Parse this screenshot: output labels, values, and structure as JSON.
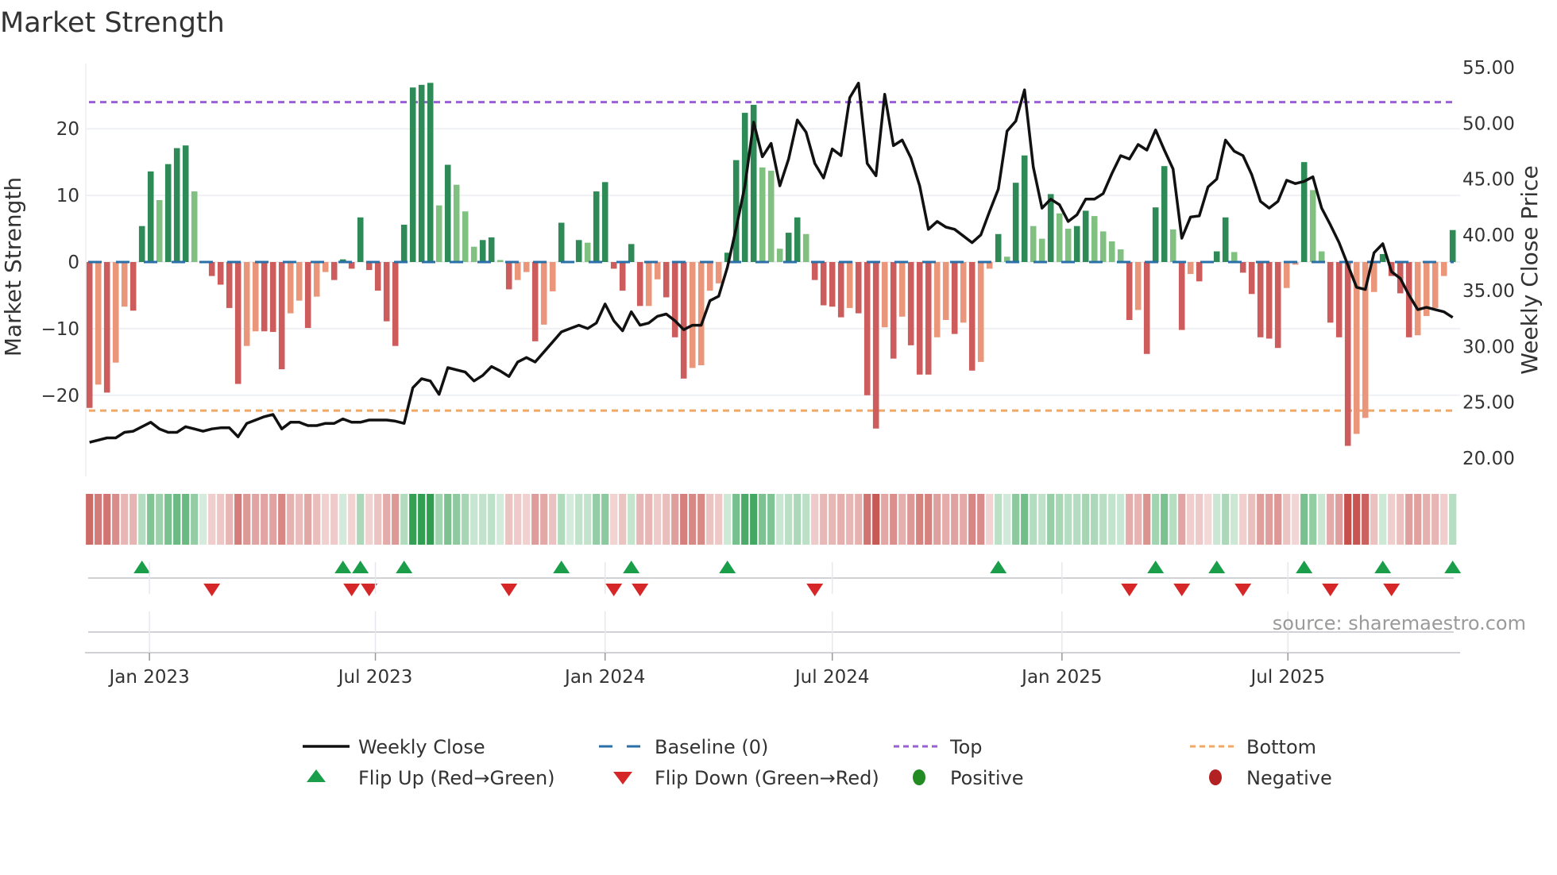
{
  "title": "Market Strength",
  "source": "source: sharemaestro.com",
  "legend": {
    "weekly_close": "Weekly Close",
    "baseline": "Baseline (0)",
    "top": "Top",
    "bottom": "Bottom",
    "flip_up": "Flip Up (Red→Green)",
    "flip_down": "Flip Down (Green→Red)",
    "positive": "Positive",
    "negative": "Negative"
  },
  "colors": {
    "strong_positive": "#2e8b57",
    "weak_positive": "#80c080",
    "strong_negative": "#cd5c5c",
    "weak_negative": "#e9967a",
    "baseline": "#2a6fa8",
    "top": "#9a5fd6",
    "bottom": "#f0a868",
    "close": "#111111",
    "flip_up": "#1a9e4a",
    "flip_down": "#d62728",
    "positive": "#228b22",
    "negative": "#b22222"
  },
  "chart_data": {
    "type": "bar+line",
    "title": "Market Strength",
    "ylabel": "Market Strength",
    "ylabel_right": "Weekly Close Price",
    "start_week": "2022-11-14",
    "frequency": "weekly",
    "ylim": [
      -29.8,
      29.8
    ],
    "ylim_right": [
      19.77,
      55.36
    ],
    "y_ticks_left": [
      "20",
      "10",
      "0",
      "−10",
      "−20"
    ],
    "y_tick_values_left": [
      20,
      10,
      0,
      -10,
      -20
    ],
    "y_ticks_right": [
      "55.00",
      "50.00",
      "45.00",
      "40.00",
      "35.00",
      "30.00",
      "25.00",
      "20.00"
    ],
    "y_tick_values_right": [
      55,
      50,
      45,
      40,
      35,
      30,
      25,
      20
    ],
    "x_ticks": [
      {
        "label": "Jan 2023",
        "date": "2023-01-01"
      },
      {
        "label": "Jul 2023",
        "date": "2023-07-01"
      },
      {
        "label": "Jan 2024",
        "date": "2024-01-01"
      },
      {
        "label": "Jul 2024",
        "date": "2024-07-01"
      },
      {
        "label": "Jan 2025",
        "date": "2025-01-01"
      },
      {
        "label": "Jul 2025",
        "date": "2025-07-01"
      }
    ],
    "top_level": 24.0,
    "bottom_level": -22.3,
    "baseline": 0,
    "strength": [
      -21.9,
      -18.4,
      -19.6,
      -15.1,
      -6.7,
      -7.3,
      5.4,
      13.6,
      9.3,
      14.7,
      17.1,
      17.5,
      10.6,
      0.1,
      -2.1,
      -3.4,
      -6.9,
      -18.3,
      -12.6,
      -10.4,
      -10.4,
      -10.5,
      -16.1,
      -7.7,
      -5.8,
      -9.9,
      -5.2,
      -1.5,
      -2.7,
      0.4,
      -1.0,
      6.7,
      -1.2,
      -4.3,
      -8.9,
      -12.6,
      5.6,
      26.2,
      26.6,
      26.9,
      8.5,
      14.6,
      11.6,
      7.6,
      2.3,
      3.3,
      3.7,
      0.3,
      -4.1,
      -2.7,
      -1.5,
      -11.9,
      -9.4,
      -4.4,
      5.9,
      0.1,
      3.3,
      2.9,
      10.6,
      12.0,
      -1.0,
      -4.3,
      2.7,
      -6.6,
      -6.6,
      -2.6,
      -5.3,
      -11.3,
      -17.5,
      -15.9,
      -15.5,
      -4.3,
      -3.2,
      1.4,
      15.3,
      22.4,
      23.6,
      14.2,
      13.7,
      2.0,
      4.4,
      6.7,
      4.2,
      -2.7,
      -6.5,
      -6.7,
      -8.3,
      -6.9,
      -7.7,
      -20.0,
      -25.0,
      -9.8,
      -14.5,
      -8.2,
      -12.5,
      -16.9,
      -16.9,
      -11.3,
      -8.7,
      -10.8,
      -9.1,
      -16.3,
      -15.0,
      -1.0,
      4.2,
      0.8,
      11.9,
      16.0,
      5.4,
      3.5,
      10.2,
      7.3,
      5.0,
      5.4,
      7.7,
      6.9,
      4.6,
      3.1,
      1.9,
      -8.7,
      -7.2,
      -13.8,
      8.2,
      14.4,
      4.9,
      -10.2,
      -1.8,
      -2.9,
      -0.1,
      1.6,
      6.7,
      1.5,
      -1.6,
      -4.8,
      -11.3,
      -11.5,
      -12.9,
      -3.9,
      -0.4,
      15.0,
      10.8,
      1.6,
      -9.1,
      -11.3,
      -27.6,
      -25.8,
      -23.4,
      -4.5,
      1.2,
      -2.1,
      -4.7,
      -11.3,
      -11.0,
      -8.1,
      -6.9,
      -2.1,
      4.8
    ],
    "strong": [
      1,
      0,
      1,
      0,
      0,
      1,
      1,
      1,
      0,
      1,
      1,
      1,
      0,
      0,
      1,
      1,
      1,
      1,
      0,
      0,
      1,
      1,
      1,
      0,
      0,
      1,
      0,
      0,
      1,
      1,
      1,
      1,
      1,
      1,
      1,
      1,
      1,
      1,
      1,
      1,
      0,
      1,
      0,
      0,
      0,
      1,
      1,
      0,
      1,
      0,
      0,
      1,
      0,
      0,
      1,
      0,
      1,
      0,
      1,
      1,
      1,
      1,
      1,
      1,
      0,
      0,
      1,
      1,
      1,
      0,
      0,
      0,
      0,
      1,
      1,
      1,
      1,
      0,
      0,
      0,
      1,
      1,
      0,
      1,
      1,
      1,
      1,
      0,
      1,
      1,
      1,
      0,
      1,
      0,
      1,
      1,
      1,
      0,
      0,
      1,
      0,
      1,
      0,
      0,
      1,
      0,
      1,
      1,
      0,
      0,
      1,
      0,
      0,
      1,
      1,
      0,
      0,
      0,
      0,
      1,
      0,
      1,
      1,
      1,
      0,
      1,
      0,
      1,
      0,
      1,
      1,
      0,
      1,
      1,
      1,
      1,
      1,
      0,
      0,
      1,
      0,
      0,
      1,
      1,
      1,
      0,
      0,
      0,
      1,
      1,
      1,
      1,
      0,
      0,
      0,
      0,
      1
    ],
    "weekly_close": [
      21.4,
      21.6,
      21.8,
      21.8,
      22.3,
      22.4,
      22.8,
      23.2,
      22.6,
      22.3,
      22.3,
      22.8,
      22.6,
      22.4,
      22.6,
      22.7,
      22.7,
      21.9,
      23.1,
      23.4,
      23.7,
      23.9,
      22.6,
      23.2,
      23.2,
      22.9,
      22.9,
      23.1,
      23.1,
      23.5,
      23.2,
      23.2,
      23.4,
      23.4,
      23.4,
      23.3,
      23.1,
      26.3,
      27.1,
      26.9,
      25.7,
      28.1,
      27.9,
      27.7,
      26.9,
      27.4,
      28.2,
      27.8,
      27.3,
      28.6,
      29.0,
      28.6,
      29.5,
      30.4,
      31.3,
      31.6,
      31.9,
      31.6,
      32.1,
      33.8,
      32.3,
      31.4,
      33.1,
      31.9,
      32.1,
      32.7,
      32.9,
      32.3,
      31.5,
      31.9,
      31.9,
      34.1,
      34.5,
      37.1,
      40.6,
      44.4,
      50.1,
      47.0,
      48.2,
      44.4,
      46.8,
      50.3,
      49.2,
      46.4,
      45.1,
      47.7,
      47.1,
      52.3,
      53.6,
      46.4,
      45.3,
      52.6,
      48.0,
      48.5,
      46.9,
      44.4,
      40.5,
      41.2,
      40.7,
      40.5,
      39.9,
      39.3,
      40.0,
      42.1,
      44.1,
      49.3,
      50.2,
      53.0,
      46.1,
      42.4,
      43.2,
      42.7,
      41.2,
      41.8,
      43.2,
      43.2,
      43.7,
      45.5,
      47.1,
      46.8,
      48.1,
      47.6,
      49.4,
      47.6,
      45.9,
      39.7,
      41.6,
      41.7,
      44.3,
      45.0,
      48.5,
      47.5,
      47.1,
      45.4,
      43.0,
      42.4,
      43.0,
      44.9,
      44.6,
      44.8,
      45.2,
      42.4,
      40.9,
      39.3,
      37.3,
      35.3,
      35.1,
      38.4,
      39.2,
      36.7,
      36.1,
      34.6,
      33.3,
      33.5,
      33.3,
      33.1,
      32.6
    ],
    "flip_up_weeks": [
      6,
      29,
      31,
      36,
      54,
      62,
      73,
      104,
      122,
      129,
      139,
      148,
      156
    ],
    "flip_down_weeks": [
      14,
      30,
      32,
      48,
      60,
      63,
      83,
      119,
      125,
      132,
      142,
      149
    ]
  }
}
